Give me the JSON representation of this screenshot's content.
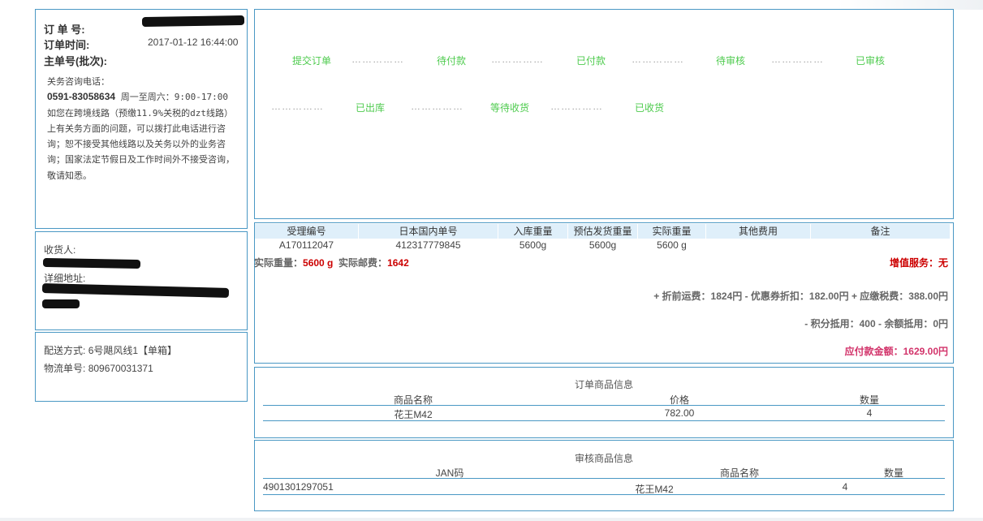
{
  "order": {
    "order_no_label": "订 单 号:",
    "order_time_label": "订单时间:",
    "order_time": "2017-01-12 16:44:00",
    "master_no_label": "主单号(批次):",
    "customs_intro": "关务咨询电话：",
    "customs_phone": "0591-83058634",
    "customs_hours": "周一至周六：9:00-17:00",
    "customs_body": "如您在跨境线路（预缴11.9%关税的dzt线路）上有关务方面的问题，可以拨打此电话进行咨询；恕不接受其他线路以及关务以外的业务咨询；国家法定节假日及工作时间外不接受咨询，敬请知悉。"
  },
  "receiver": {
    "name_label": "收货人:",
    "address_label": "详细地址:"
  },
  "delivery": {
    "method_label": "配送方式:",
    "method": "6号飓风线1【单箱】",
    "tracking_label": "物流单号:",
    "tracking_no": "809670031371"
  },
  "status_flow": {
    "steps": [
      "提交订单",
      "待付款",
      "已付款",
      "待审核",
      "已审核",
      "已出库",
      "等待收货",
      "已收货"
    ],
    "separator": "……………"
  },
  "shipment": {
    "headers": [
      "受理编号",
      "日本国内单号",
      "入库重量",
      "预估发货重量",
      "实际重量",
      "其他费用",
      "备注"
    ],
    "row": [
      "A170112047",
      "412317779845",
      "5600g",
      "5600g",
      "5600 g",
      "",
      ""
    ],
    "actual_weight_label": "实际重量：",
    "actual_weight": "5600 g",
    "actual_postage_label": "实际邮费：",
    "actual_postage": "1642",
    "value_added": "增值服务：无",
    "fee_line": "+ 折前运费：1824円 - 优惠券折扣：182.00円 + 应缴税费：388.00円",
    "deduct_line": "- 积分抵用：400 - 余额抵用：0円",
    "payable_label": "应付款金额：",
    "payable": "1629.00円"
  },
  "order_goods": {
    "title": "订单商品信息",
    "headers": [
      "商品名称",
      "价格",
      "数量"
    ],
    "rows": [
      [
        "花王M42",
        "782.00",
        "4"
      ]
    ]
  },
  "review_goods": {
    "title": "审核商品信息",
    "headers": [
      "JAN码",
      "商品名称",
      "数量"
    ],
    "rows": [
      [
        "4901301297051",
        "花王M42",
        "4"
      ]
    ]
  },
  "colors": {
    "border": "#4a98c4",
    "status_green": "#4ecb4e",
    "header_bg": "#dfeffa",
    "red": "#cc0000",
    "pink": "#d2336a"
  }
}
